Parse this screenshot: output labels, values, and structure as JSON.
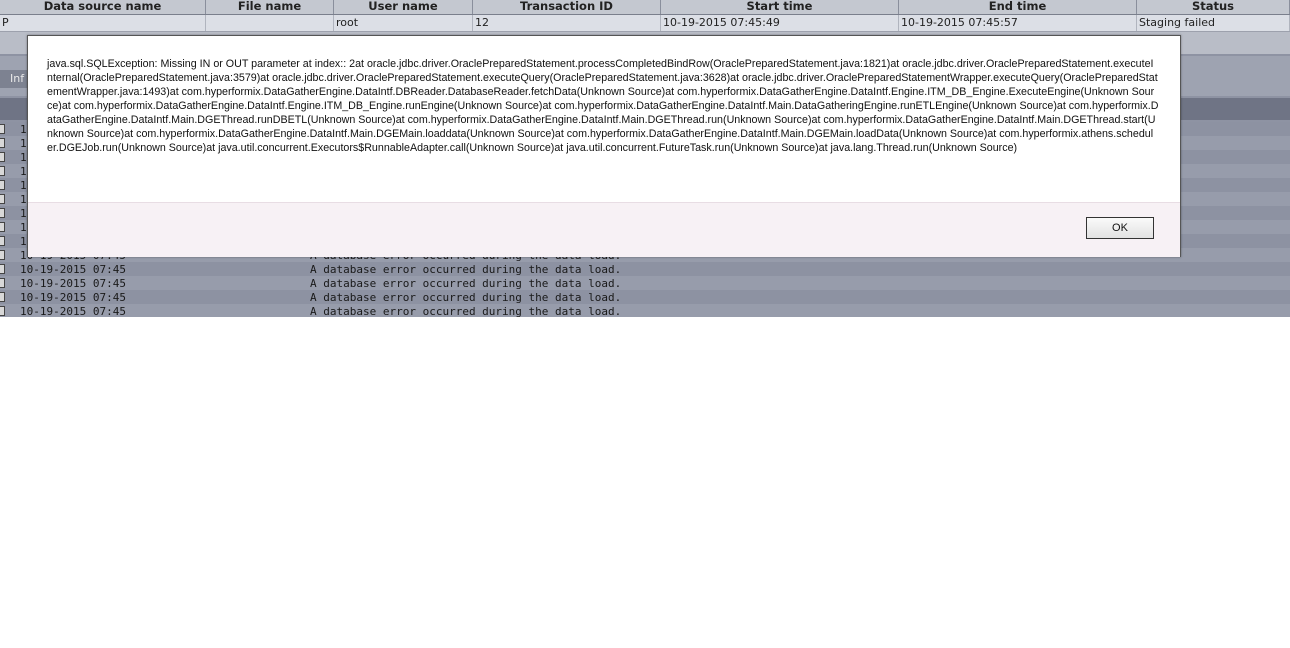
{
  "table": {
    "headers": [
      "Data source name",
      "File name",
      "User name",
      "Transaction ID",
      "Start time",
      "End time",
      "Status"
    ],
    "row": [
      "P",
      "",
      "root",
      "12",
      "10-19-2015 07:45:49",
      "10-19-2015 07:45:57",
      "Staging failed"
    ]
  },
  "tabs": {
    "info_label": "Inf"
  },
  "log": {
    "rows": [
      {
        "time": "1",
        "message": ""
      },
      {
        "time": "1",
        "message": ""
      },
      {
        "time": "1",
        "message": ""
      },
      {
        "time": "1",
        "message": ""
      },
      {
        "time": "1",
        "message": ""
      },
      {
        "time": "1",
        "message": ""
      },
      {
        "time": "1",
        "message": ""
      },
      {
        "time": "1",
        "message": ""
      },
      {
        "time": "1",
        "message": ""
      },
      {
        "time": "10-19-2015 07:45",
        "message": "A database error occurred during the data load."
      },
      {
        "time": "10-19-2015 07:45",
        "message": "A database error occurred during the data load."
      },
      {
        "time": "10-19-2015 07:45",
        "message": "A database error occurred during the data load."
      },
      {
        "time": "10-19-2015 07:45",
        "message": "A database error occurred during the data load."
      },
      {
        "time": "10-19-2015 07:45",
        "message": "A database error occurred during the data load."
      }
    ]
  },
  "dialog": {
    "message": "java.sql.SQLException: Missing IN or OUT parameter at index:: 2at oracle.jdbc.driver.OraclePreparedStatement.processCompletedBindRow(OraclePreparedStatement.java:1821)at oracle.jdbc.driver.OraclePreparedStatement.executeInternal(OraclePreparedStatement.java:3579)at oracle.jdbc.driver.OraclePreparedStatement.executeQuery(OraclePreparedStatement.java:3628)at oracle.jdbc.driver.OraclePreparedStatementWrapper.executeQuery(OraclePreparedStatementWrapper.java:1493)at com.hyperformix.DataGatherEngine.DataIntf.DBReader.DatabaseReader.fetchData(Unknown Source)at com.hyperformix.DataGatherEngine.DataIntf.Engine.ITM_DB_Engine.ExecuteEngine(Unknown Source)at com.hyperformix.DataGatherEngine.DataIntf.Engine.ITM_DB_Engine.runEngine(Unknown Source)at com.hyperformix.DataGatherEngine.DataIntf.Main.DataGatheringEngine.runETLEngine(Unknown Source)at com.hyperformix.DataGatherEngine.DataIntf.Main.DGEThread.runDBETL(Unknown Source)at com.hyperformix.DataGatherEngine.DataIntf.Main.DGEThread.run(Unknown Source)at com.hyperformix.DataGatherEngine.DataIntf.Main.DGEThread.start(Unknown Source)at com.hyperformix.DataGatherEngine.DataIntf.Main.DGEMain.loaddata(Unknown Source)at com.hyperformix.DataGatherEngine.DataIntf.Main.DGEMain.loadData(Unknown Source)at com.hyperformix.athens.scheduler.DGEJob.run(Unknown Source)at java.util.concurrent.Executors$RunnableAdapter.call(Unknown Source)at java.util.concurrent.FutureTask.run(Unknown Source)at java.lang.Thread.run(Unknown Source)",
    "ok_label": "OK"
  }
}
